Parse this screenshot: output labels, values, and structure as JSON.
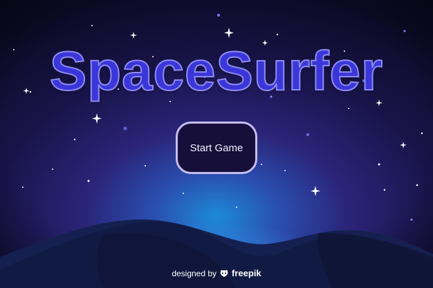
{
  "game": {
    "title": "SpaceSurfer",
    "start_button_label": "Start Game"
  },
  "credit": {
    "prefix": "designed by",
    "brand": "freepik",
    "mascot_icon": "freepik-logo-icon"
  },
  "colors": {
    "sky_top": "#0d0b2b",
    "sky_mid": "#2a1e6b",
    "horizon_glow": "#1e78c8",
    "dunes": "#141a3e",
    "title_fill": "#3b36d9",
    "title_outline": "#8e8cf0",
    "button_border": "#c8bdf2",
    "button_fill": "#150f3a"
  }
}
